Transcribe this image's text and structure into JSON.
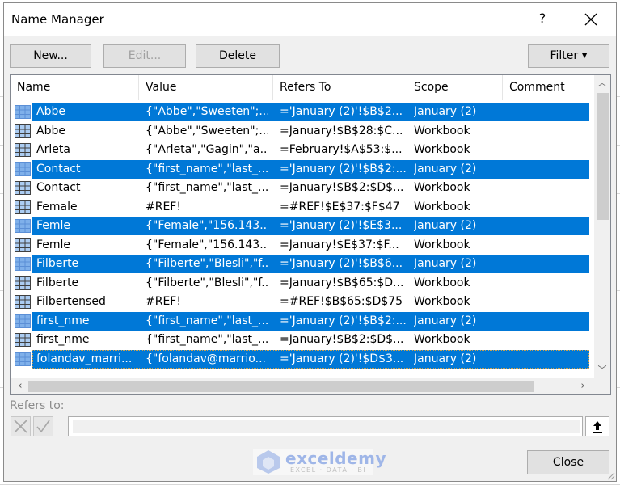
{
  "dialog": {
    "title": "Name Manager",
    "help_label": "?",
    "close_icon": "close-icon"
  },
  "toolbar": {
    "new_label": "New...",
    "edit_label": "Edit...",
    "delete_label": "Delete",
    "filter_label": "Filter",
    "filter_icon": "dropdown-arrow-icon"
  },
  "table": {
    "columns": [
      "Name",
      "Value",
      "Refers To",
      "Scope",
      "Comment"
    ],
    "rows": [
      {
        "name": "Abbe",
        "value": "{\"Abbe\",\"Sweeten\";...",
        "refers_to": "='January (2)'!$B$2...",
        "scope": "January (2)",
        "comment": "",
        "selected": true
      },
      {
        "name": "Abbe",
        "value": "{\"Abbe\",\"Sweeten\";...",
        "refers_to": "=January!$B$28:$C...",
        "scope": "Workbook",
        "comment": "",
        "selected": false
      },
      {
        "name": "Arleta",
        "value": "{\"Arleta\",\"Gagin\",\"a...",
        "refers_to": "=February!$A$53:$...",
        "scope": "Workbook",
        "comment": "",
        "selected": false
      },
      {
        "name": "Contact",
        "value": "{\"first_name\",\"last_...",
        "refers_to": "='January (2)'!$B$2:...",
        "scope": "January (2)",
        "comment": "",
        "selected": true
      },
      {
        "name": "Contact",
        "value": "{\"first_name\",\"last_...",
        "refers_to": "=January!$B$2:$D$...",
        "scope": "Workbook",
        "comment": "",
        "selected": false
      },
      {
        "name": "Female",
        "value": "#REF!",
        "refers_to": "=#REF!$E$37:$F$47",
        "scope": "Workbook",
        "comment": "",
        "selected": false
      },
      {
        "name": "Femle",
        "value": "{\"Female\",\"156.143....",
        "refers_to": "='January (2)'!$E$3...",
        "scope": "January (2)",
        "comment": "",
        "selected": true
      },
      {
        "name": "Femle",
        "value": "{\"Female\",\"156.143....",
        "refers_to": "=January!$E$37:$F...",
        "scope": "Workbook",
        "comment": "",
        "selected": false
      },
      {
        "name": "Filberte",
        "value": "{\"Filberte\",\"Blesli\",\"f...",
        "refers_to": "='January (2)'!$B$6...",
        "scope": "January (2)",
        "comment": "",
        "selected": true
      },
      {
        "name": "Filberte",
        "value": "{\"Filberte\",\"Blesli\",\"f...",
        "refers_to": "=January!$B$65:$D...",
        "scope": "Workbook",
        "comment": "",
        "selected": false
      },
      {
        "name": "Filbertensed",
        "value": "#REF!",
        "refers_to": "=#REF!$B$65:$D$75",
        "scope": "Workbook",
        "comment": "",
        "selected": false
      },
      {
        "name": "first_nme",
        "value": "{\"first_name\",\"last_...",
        "refers_to": "='January (2)'!$B$2:...",
        "scope": "January (2)",
        "comment": "",
        "selected": true
      },
      {
        "name": "first_nme",
        "value": "{\"first_name\",\"last_...",
        "refers_to": "=January!$B$2:$D$...",
        "scope": "Workbook",
        "comment": "",
        "selected": false
      },
      {
        "name": "folandav_marri...",
        "value": "{\"folandav@marrio...",
        "refers_to": "='January (2)'!$D$3...",
        "scope": "January (2)",
        "comment": "",
        "selected": true,
        "focused": true
      }
    ]
  },
  "refers_to": {
    "label": "Refers to:",
    "value": ""
  },
  "footer": {
    "close_label": "Close"
  },
  "watermark": {
    "brand": "exceldemy",
    "tagline": "EXCEL · DATA · BI"
  },
  "colors": {
    "selection": "#0078d7",
    "dialog_bg": "#f0f0f0"
  }
}
